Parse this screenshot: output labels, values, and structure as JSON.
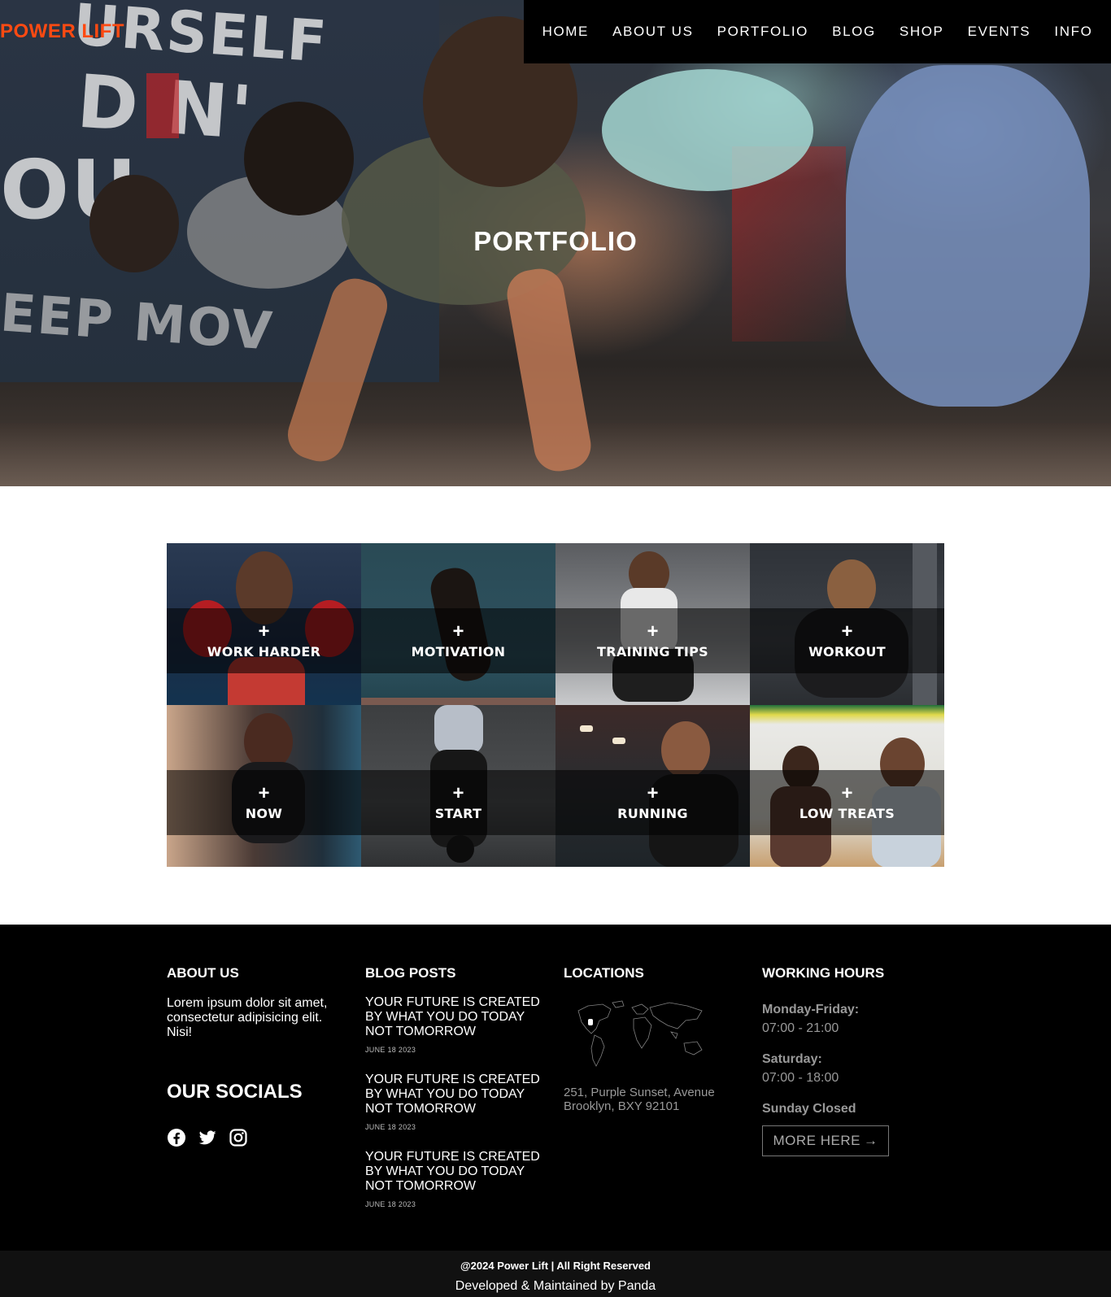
{
  "header": {
    "brand": "POWER LIFT",
    "nav": [
      "HOME",
      "ABOUT US",
      "PORTFOLIO",
      "BLOG",
      "SHOP",
      "EVENTS",
      "INFO"
    ]
  },
  "hero": {
    "title": "PORTFOLIO"
  },
  "gallery": {
    "plus": "+",
    "tiles": [
      {
        "label": "WORK HARDER"
      },
      {
        "label": "MOTIVATION"
      },
      {
        "label": "TRAINING TIPS"
      },
      {
        "label": "WORKOUT"
      },
      {
        "label": "NOW"
      },
      {
        "label": "START"
      },
      {
        "label": "RUNNING"
      },
      {
        "label": "LOW TREATS"
      }
    ]
  },
  "footer": {
    "about": {
      "heading": "ABOUT US",
      "text": "Lorem ipsum dolor sit amet, consectetur adipisicing elit. Nisi!"
    },
    "socials": {
      "heading": "OUR SOCIALS",
      "icons": [
        "facebook-icon",
        "twitter-icon",
        "instagram-icon"
      ]
    },
    "blog": {
      "heading": "BLOG POSTS",
      "posts": [
        {
          "title": "YOUR FUTURE IS CREATED BY WHAT YOU DO TODAY NOT TOMORROW",
          "date": "JUNE 18 2023"
        },
        {
          "title": "YOUR FUTURE IS CREATED BY WHAT YOU DO TODAY NOT TOMORROW",
          "date": "JUNE 18 2023"
        },
        {
          "title": "YOUR FUTURE IS CREATED BY WHAT YOU DO TODAY NOT TOMORROW",
          "date": "JUNE 18 2023"
        }
      ]
    },
    "locations": {
      "heading": "LOCATIONS",
      "address_line1": "251, Purple Sunset, Avenue",
      "address_line2": "Brooklyn, BXY 92101"
    },
    "hours": {
      "heading": "WORKING HOURS",
      "weekday_label": "Monday-Friday:",
      "weekday_time": "07:00 - 21:00",
      "saturday_label": "Saturday:",
      "saturday_time": "07:00 - 18:00",
      "sunday": "Sunday Closed",
      "more_label": "MORE HERE",
      "more_arrow": "→"
    },
    "copyright": "@2024 Power Lift | All Right Reserved",
    "developer": "Developed & Maintained by Panda"
  },
  "colors": {
    "brand": "#ff4a12",
    "nav_bg": "#000000",
    "footer_bg": "#000000"
  }
}
